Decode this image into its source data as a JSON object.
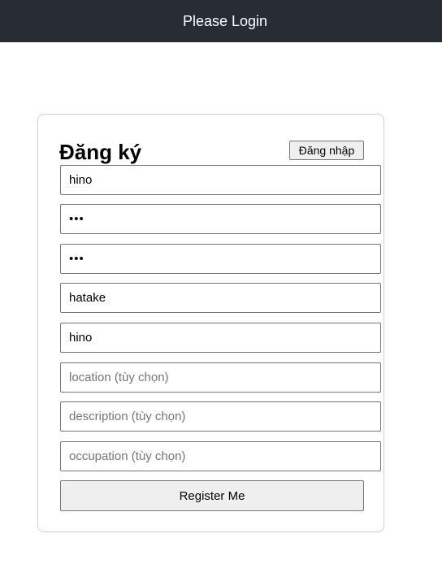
{
  "header": {
    "title": "Please Login"
  },
  "form": {
    "title": "Đăng ký",
    "login_button_label": "Đăng nhập",
    "fields": {
      "username": {
        "value": "hino",
        "placeholder": ""
      },
      "password": {
        "value": "abc",
        "placeholder": ""
      },
      "confirm_password": {
        "value": "abc",
        "placeholder": ""
      },
      "last_name": {
        "value": "hatake",
        "placeholder": ""
      },
      "first_name": {
        "value": "hino",
        "placeholder": ""
      },
      "location": {
        "value": "",
        "placeholder": "location (tùy chọn)"
      },
      "description": {
        "value": "",
        "placeholder": "description (tùy chọn)"
      },
      "occupation": {
        "value": "",
        "placeholder": "occupation (tùy chọn)"
      }
    },
    "register_button_label": "Register Me"
  },
  "colors": {
    "header_background": "#282c34",
    "header_text": "#ffffff",
    "card_border": "#cfcfcf",
    "button_background": "#efefef"
  }
}
